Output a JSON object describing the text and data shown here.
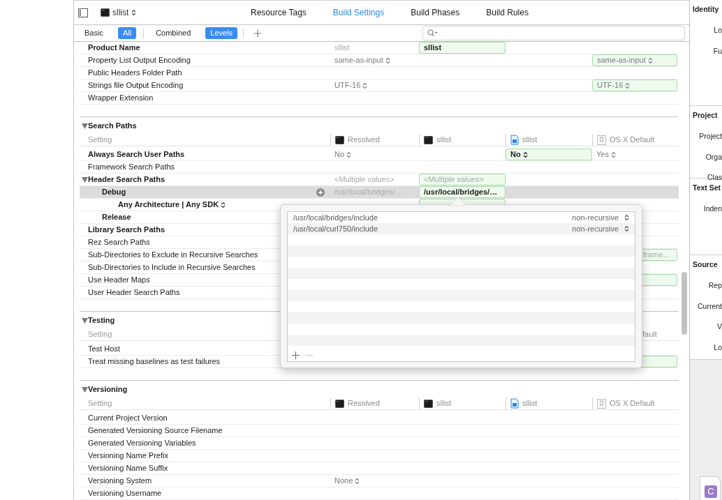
{
  "toolbar": {
    "target": {
      "label": "sllist",
      "popup": true
    },
    "tabs": [
      {
        "label": "Resource Tags",
        "selected": false
      },
      {
        "label": "Build Settings",
        "selected": true
      },
      {
        "label": "Build Phases",
        "selected": false
      },
      {
        "label": "Build Rules",
        "selected": false
      }
    ]
  },
  "filter_bar": {
    "scope": [
      {
        "label": "Basic",
        "selected": false
      },
      {
        "label": "All",
        "selected": true
      }
    ],
    "view": [
      {
        "label": "Combined",
        "selected": false
      },
      {
        "label": "Levels",
        "selected": true
      }
    ]
  },
  "sections": [
    {
      "rows": [
        {
          "name": "Product Name",
          "bold": true,
          "cells": {
            "resolved": {
              "text": "sllist",
              "dim": true
            },
            "target": {
              "text": "sllist",
              "bold": true,
              "defined": true
            }
          }
        },
        {
          "name": "Property List Output Encoding",
          "cells": {
            "resolved": {
              "text": "same-as-input",
              "popup": true
            },
            "default": {
              "text": "same-as-input",
              "popup": true,
              "defined": true
            }
          }
        },
        {
          "name": "Public Headers Folder Path"
        },
        {
          "name": "Strings file Output Encoding",
          "cells": {
            "resolved": {
              "text": "UTF-16",
              "popup": true
            },
            "default": {
              "text": "UTF-16",
              "popup": true,
              "defined": true
            }
          }
        },
        {
          "name": "Wrapper Extension"
        }
      ]
    },
    {
      "title": "Search Paths",
      "expanded": true,
      "header": {
        "setting": "Setting",
        "columns": {
          "resolved": {
            "label": "Resolved",
            "kind": "terminal"
          },
          "target": {
            "label": "sllist",
            "kind": "terminal"
          },
          "project": {
            "label": "sllist",
            "kind": "project"
          },
          "default": {
            "label": "OS X Default",
            "kind": "default"
          }
        }
      },
      "rows": [
        {
          "name": "Always Search User Paths",
          "bold": true,
          "cells": {
            "resolved": {
              "text": "No",
              "popup": true
            },
            "project": {
              "text": "No",
              "popup": true,
              "bold": true,
              "defined": true
            },
            "default": {
              "text": "Yes",
              "popup": true
            }
          }
        },
        {
          "name": "Framework Search Paths"
        },
        {
          "name": "Header Search Paths",
          "bold": true,
          "expanded": true,
          "cells": {
            "resolved": {
              "text": "<Multiple values>",
              "dim": true
            },
            "target": {
              "text": "<Multiple values>",
              "dim": true,
              "defined": true
            }
          },
          "children": [
            {
              "name": "Debug",
              "bold": true,
              "selected": true,
              "cells": {
                "resolved": {
                  "text": "/usr/local/bridges/…",
                  "dim": true
                },
                "target": {
                  "text": "/usr/local/bridges/…",
                  "bold": true,
                  "defined": true
                }
              },
              "children": [
                {
                  "name": "Any Architecture | Any SDK",
                  "bold": true,
                  "popup": true,
                  "selected": false,
                  "cells": {
                    "target": {
                      "defined": true
                    }
                  }
                }
              ]
            },
            {
              "name": "Release",
              "bold": true,
              "selected": false
            }
          ]
        },
        {
          "name": "Library Search Paths",
          "bold": true
        },
        {
          "name": "Rez Search Paths"
        },
        {
          "name": "Sub-Directories to Exclude in Recursive Searches",
          "cells": {
            "default": {
              "text": "frame…",
              "dim": true,
              "defined": true,
              "behind": true
            }
          }
        },
        {
          "name": "Sub-Directories to Include in Recursive Searches"
        },
        {
          "name": "Use Header Maps",
          "cells": {
            "default": {
              "defined": true
            }
          }
        },
        {
          "name": "User Header Search Paths"
        }
      ]
    },
    {
      "title": "Testing",
      "expanded": true,
      "header": {
        "setting": "Setting",
        "columns": {
          "default": {
            "label": "fault",
            "kind": "none",
            "behind": true
          }
        }
      },
      "rows": [
        {
          "name": "Test Host"
        },
        {
          "name": "Treat missing baselines as test failures",
          "cells": {
            "default": {
              "defined": true
            }
          }
        }
      ]
    },
    {
      "title": "Versioning",
      "expanded": true,
      "header": {
        "setting": "Setting",
        "columns": {
          "resolved": {
            "label": "Resolved",
            "kind": "terminal"
          },
          "target": {
            "label": "sllist",
            "kind": "terminal"
          },
          "project": {
            "label": "sllist",
            "kind": "project"
          },
          "default": {
            "label": "OS X Default",
            "kind": "default"
          }
        }
      },
      "rows": [
        {
          "name": "Current Project Version"
        },
        {
          "name": "Generated Versioning Source Filename"
        },
        {
          "name": "Generated Versioning Variables"
        },
        {
          "name": "Versioning Name Prefix"
        },
        {
          "name": "Versioning Name Suffix"
        },
        {
          "name": "Versioning System",
          "cells": {
            "resolved": {
              "text": "None",
              "popup": true
            }
          }
        },
        {
          "name": "Versioning Username"
        }
      ]
    }
  ],
  "popover": {
    "paths": [
      {
        "path": "/usr/local/bridges/include",
        "recursion": "non-recursive"
      },
      {
        "path": "/usr/local/curl750/include",
        "recursion": "non-recursive"
      }
    ]
  },
  "inspector": {
    "groups": [
      {
        "heading": "Identity",
        "labels": [
          "Lo",
          "Fu"
        ]
      },
      {
        "heading": "Project",
        "labels": [
          "Project",
          "Orga",
          "Clas"
        ]
      },
      {
        "heading": "Text Set",
        "labels": [
          "Inden"
        ]
      },
      {
        "heading": "Source",
        "labels": [
          "Rep",
          "Current",
          "V",
          "Lo"
        ]
      }
    ],
    "file_badge": "C"
  }
}
